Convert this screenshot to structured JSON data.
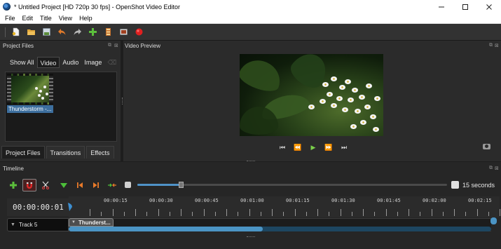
{
  "window": {
    "title": "* Untitled Project [HD 720p 30 fps] - OpenShot Video Editor",
    "controls": [
      "minimize",
      "maximize",
      "close"
    ]
  },
  "menu": [
    "File",
    "Edit",
    "Title",
    "View",
    "Help"
  ],
  "toolbar": {
    "icons": [
      "new-project-icon",
      "open-project-icon",
      "save-project-icon",
      "undo-icon",
      "redo-icon",
      "import-files-icon",
      "choose-profile-icon",
      "fullscreen-icon",
      "export-video-icon"
    ],
    "colors": {
      "undo": "#e07a2a",
      "import": "#5cc03c",
      "export": "#e02020"
    }
  },
  "project_files": {
    "title": "Project Files",
    "filters": [
      "Show All",
      "Video",
      "Audio",
      "Image"
    ],
    "active_filter": "Video",
    "files": [
      {
        "label": "Thunderstorm -..."
      }
    ],
    "tabs": [
      "Project Files",
      "Transitions",
      "Effects"
    ],
    "active_tab": "Project Files"
  },
  "video_preview": {
    "title": "Video Preview",
    "transport": [
      "jump-start-icon",
      "rewind-icon",
      "play-icon",
      "fast-forward-icon",
      "jump-end-icon"
    ]
  },
  "timeline": {
    "title": "Timeline",
    "tools": [
      "add-track-icon",
      "snap-icon",
      "razor-icon",
      "add-marker-icon",
      "previous-marker-icon",
      "next-marker-icon",
      "center-playhead-icon"
    ],
    "zoom_label": "15 seconds",
    "zoom_level": 0.14,
    "timecode": "00:00:00:01",
    "ruler_labels": [
      "00:00:15",
      "00:00:30",
      "00:00:45",
      "00:01:00",
      "00:01:15",
      "00:01:30",
      "00:01:45",
      "00:02:00",
      "00:02:15"
    ],
    "tracks": [
      {
        "label": "Track 5"
      }
    ],
    "clips": [
      {
        "label": "Thunderst..."
      }
    ],
    "scroll_fraction": 0.46,
    "accent": "#4b94c4"
  }
}
